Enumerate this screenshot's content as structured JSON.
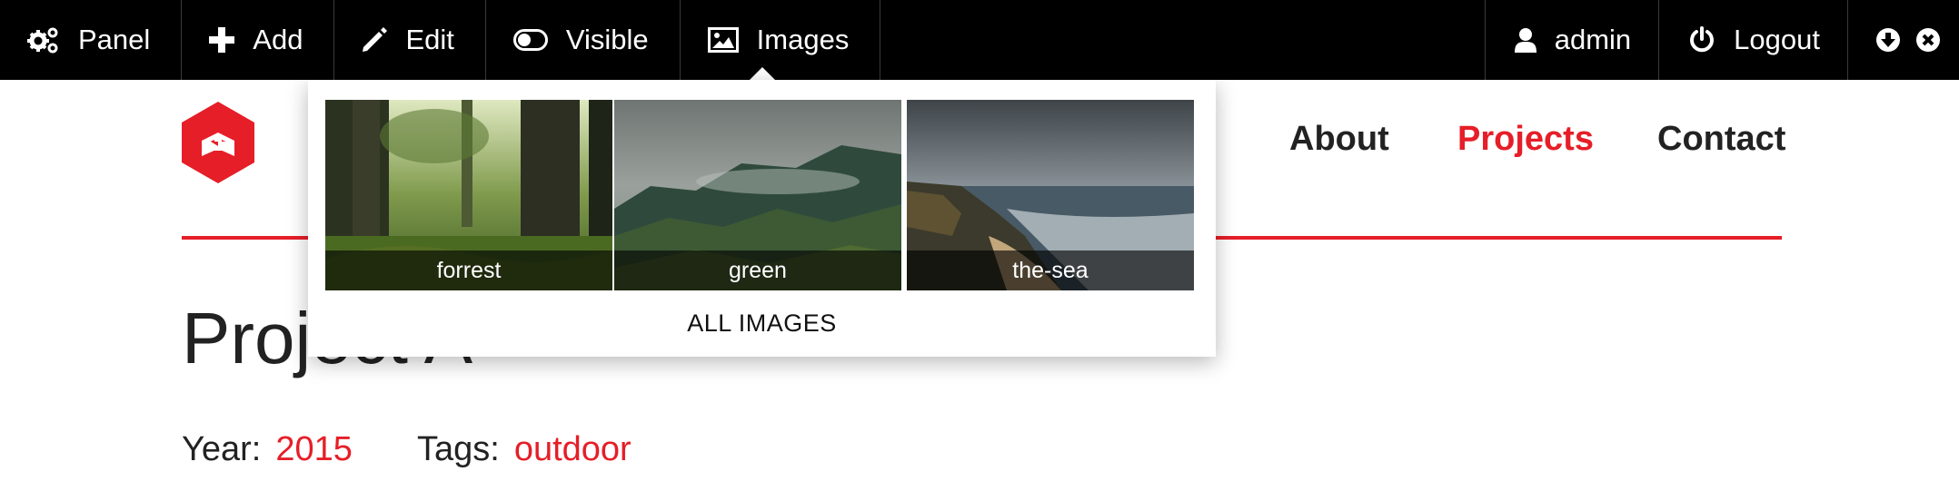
{
  "toolbar": {
    "panel": "Panel",
    "add": "Add",
    "edit": "Edit",
    "visible": "Visible",
    "images": "Images",
    "user": "admin",
    "logout": "Logout"
  },
  "nav": {
    "about": "About",
    "projects": "Projects",
    "contact": "Contact"
  },
  "page": {
    "title": "Project A",
    "year_label": "Year:",
    "year": "2015",
    "tags_label": "Tags:",
    "tag": "outdoor"
  },
  "images_menu": {
    "items": [
      {
        "caption": "forrest"
      },
      {
        "caption": "green"
      },
      {
        "caption": "the-sea"
      }
    ],
    "all_label": "ALL IMAGES"
  },
  "colors": {
    "accent": "#e61e28",
    "toolbar": "#000000"
  },
  "icons": [
    "gears-icon",
    "plus-icon",
    "pencil-icon",
    "toggle-icon",
    "image-icon",
    "user-icon",
    "power-icon",
    "arrow-down-icon",
    "close-icon"
  ]
}
